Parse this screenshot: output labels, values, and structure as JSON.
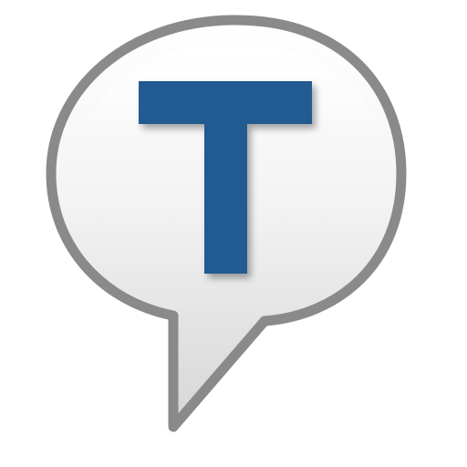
{
  "icon": {
    "name": "speech-bubble-t-icon",
    "glyph": "T",
    "colors": {
      "bubble_outline": "#8a8a8a",
      "bubble_fill_top": "#ffffff",
      "bubble_fill_bottom": "#dcdcdc",
      "letter": "#245a92"
    }
  }
}
